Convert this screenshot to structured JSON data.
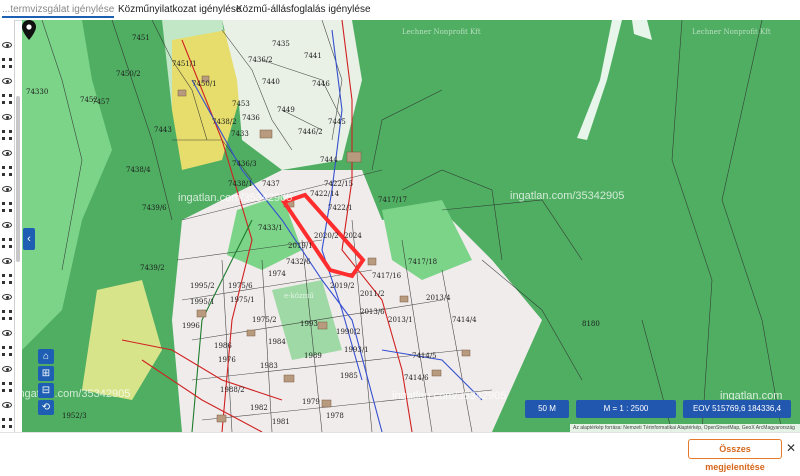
{
  "tabs": [
    {
      "label": "...termvizsgálat igénylése"
    },
    {
      "label": "Közműnyilatkozat igénylése"
    },
    {
      "label": "Közmű-állásfoglalás igénylése"
    }
  ],
  "map": {
    "watermark_text": "ingatlan.com/35342905",
    "site_watermark": "ingatlan.com",
    "parcel_labels": [
      "7451",
      "7450/2",
      "7451/1",
      "7453",
      "7450/1",
      "7452",
      "7449",
      "7446",
      "7446/2",
      "7445",
      "74330",
      "7433",
      "7436",
      "7435",
      "7436/2",
      "7441",
      "7440",
      "7443",
      "7444",
      "7438/4",
      "7436/3",
      "7457",
      "7437",
      "7438/2",
      "7438/1",
      "7422/15",
      "7422/14",
      "7422/1",
      "7433/1",
      "7417/17",
      "2024",
      "2020/2",
      "2019/1",
      "7417/18",
      "7432/6",
      "7439/6",
      "7439/2",
      "1975/6",
      "1975/1",
      "1975/2",
      "1974",
      "2019/2",
      "2011/2",
      "2013/4",
      "2013/6",
      "2013/1",
      "1995/2",
      "1995/1",
      "1996",
      "1993",
      "1984",
      "1990/2",
      "1993/1",
      "1989",
      "1986",
      "1983",
      "1988/2",
      "1982",
      "1981",
      "1979",
      "1978",
      "1985",
      "7414/5",
      "7414/6",
      "7414/4",
      "8180",
      "1952/3",
      "7417/16",
      "1976"
    ],
    "faint_labels": [
      "Lechner Nonprofit Kft",
      "Lechner Nonprofit Kft",
      "e-közmű"
    ]
  },
  "status": {
    "scale": "50 M",
    "ratio": "M = 1 : 2500",
    "coords": "EOV   515769,6   184336,4",
    "attribution": "Az alaptérkép forrása: Nemzeti Térinformatikai Alaptérkép, OpenStreetMap, GeoX ArcMagyarország"
  },
  "controls": {
    "collapse_glyph": "‹",
    "home_glyph": "⌂",
    "zoom_fit_glyph": "⊞",
    "zoom_out_glyph": "⊟",
    "back_glyph": "⟲"
  },
  "bottom": {
    "show_all_label": "Összes megjelenítése",
    "close_glyph": "✕"
  },
  "colors": {
    "forest": "#4fae62",
    "meadow": "#7cd489",
    "light_field": "#c2e7c6",
    "built_area": "#f1ecec",
    "yellow_zone": "#e6dd6c",
    "parcel_line": "#2d2d2d",
    "selection_red": "#ff2d2d",
    "pipe_red": "#d02020",
    "pipe_blue": "#3550d0",
    "pipe_green": "#1c7c2c",
    "button_blue": "#2257b0",
    "accent_orange": "#e57a2a"
  }
}
